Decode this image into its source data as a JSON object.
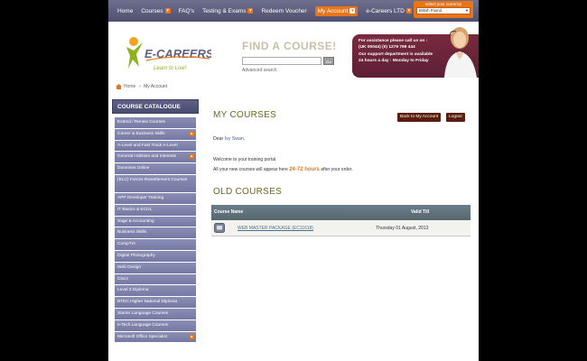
{
  "nav": {
    "items": [
      {
        "label": "Home",
        "caret": false,
        "active": false
      },
      {
        "label": "Courses",
        "caret": true,
        "active": false
      },
      {
        "label": "FAQ's",
        "caret": false,
        "active": false
      },
      {
        "label": "Testing & Exams",
        "caret": true,
        "active": false
      },
      {
        "label": "Redeem Voucher",
        "caret": false,
        "active": false
      },
      {
        "label": "My Account",
        "caret": true,
        "active": true
      },
      {
        "label": "e-Careers LTD",
        "caret": true,
        "active": false
      }
    ],
    "currency_label": "select your currency",
    "currency_value": "British Pound"
  },
  "header": {
    "logo_text": "E-CAREERS",
    "logo_tagline": "Learn to Live!",
    "find_title": "FIND A COURSE!",
    "search_placeholder": "",
    "go_label": "Go",
    "advanced_search": "Advanced search",
    "assist_lines": [
      "For assistance please call us on :",
      "(UK 00044) (0) 1279 799 444",
      "Our support department is available",
      "24 hours a day : Monday to Friday"
    ]
  },
  "breadcrumb": {
    "home": "Home",
    "current": "My Account"
  },
  "catalogue": {
    "title": "COURSE CATALOGUE",
    "items": [
      {
        "label": "Extend / Renew Courses",
        "caret": false,
        "double": false
      },
      {
        "label": "Career & Business Skills",
        "caret": true,
        "double": false
      },
      {
        "label": "A-Level and Fast Track A-Level",
        "caret": false,
        "double": false
      },
      {
        "label": "General Hobbies and Interests",
        "caret": true,
        "double": false
      },
      {
        "label": "Dummies Online",
        "caret": false,
        "double": false
      },
      {
        "label": "(ELC) Forces Resettlement Courses",
        "caret": false,
        "double": true
      },
      {
        "label": "APP Developer Training",
        "caret": false,
        "double": false
      },
      {
        "label": "IT Basics & ECDL",
        "caret": false,
        "double": false
      },
      {
        "label": "Sage & Accounting",
        "caret": false,
        "double": false
      },
      {
        "label": "Business Skills",
        "caret": false,
        "double": false
      },
      {
        "label": "CompTIA",
        "caret": false,
        "double": false
      },
      {
        "label": "Digital Photography",
        "caret": false,
        "double": false
      },
      {
        "label": "Web Design",
        "caret": false,
        "double": false
      },
      {
        "label": "Cisco",
        "caret": false,
        "double": false
      },
      {
        "label": "Level 3 Diploma",
        "caret": false,
        "double": false
      },
      {
        "label": "BTEC Higher National Diploma",
        "caret": false,
        "double": false
      },
      {
        "label": "Starter Language Courses",
        "caret": false,
        "double": false
      },
      {
        "label": "e-Tech Language Courses",
        "caret": false,
        "double": false
      },
      {
        "label": "Microsoft Office Specialist",
        "caret": true,
        "double": false
      }
    ]
  },
  "main": {
    "title": "MY COURSES",
    "back_button": "Back to My Account",
    "logout_button": "Logout",
    "dear_prefix": "Dear",
    "user_name": "Ivy Swan,",
    "welcome_line": "Welcome to your training portal.",
    "courses_line_prefix": "All your new courses will appear here",
    "courses_line_hours": "24-72 hours",
    "courses_line_suffix": "after your order.",
    "old_title": "OLD COURSES",
    "table": {
      "headers": [
        "Course Name",
        "Valid Till"
      ],
      "rows": [
        {
          "course": "WEB MASTER PACKAGE (EC11618)",
          "valid_till": "Thursday 01 August, 2013"
        }
      ]
    }
  },
  "colors": {
    "accent": "#e8751a",
    "nav": "#5a5b7c",
    "sidebar": "#7f83ab",
    "heading": "#6a6a1f",
    "button": "#5a1e0e"
  }
}
